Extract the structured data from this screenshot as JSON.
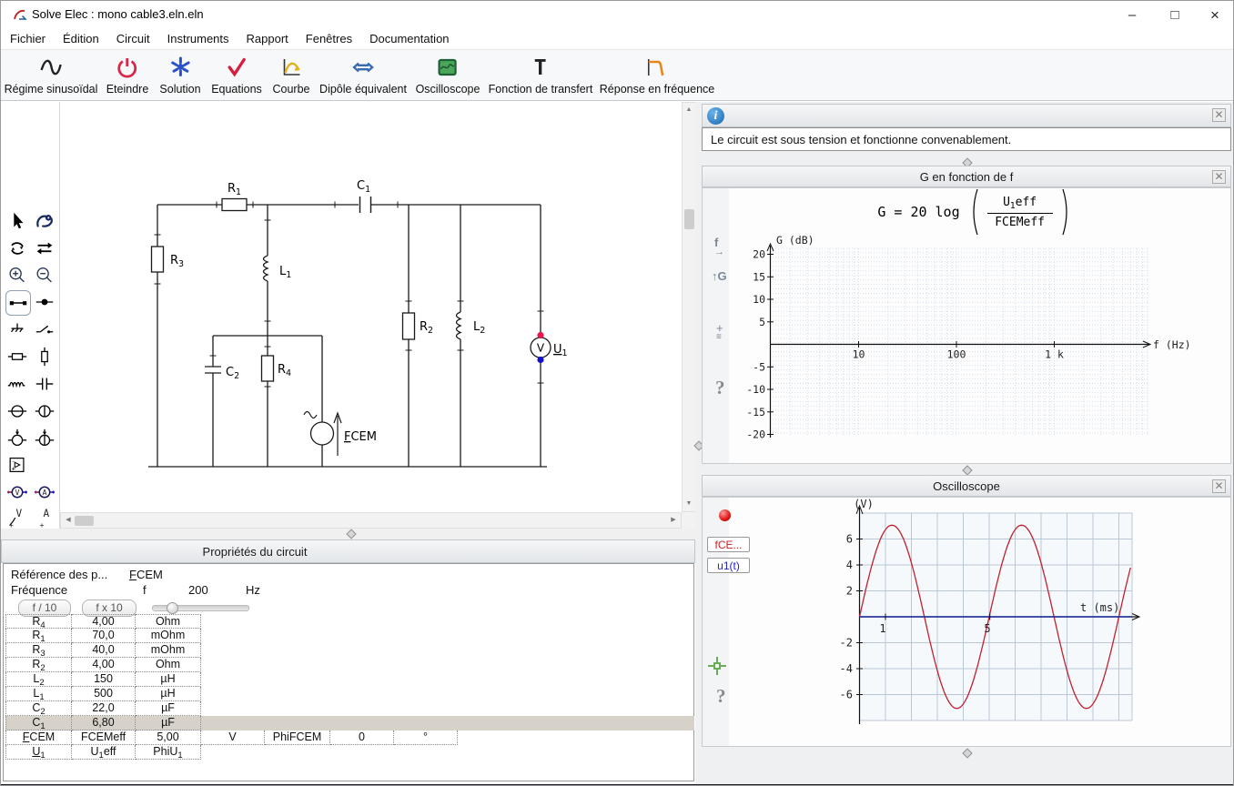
{
  "window": {
    "title": "Solve Elec : mono cable3.eln.eln"
  },
  "menubar": {
    "items": [
      "Fichier",
      "Édition",
      "Circuit",
      "Instruments",
      "Rapport",
      "Fenêtres",
      "Documentation"
    ]
  },
  "toolbar": {
    "items": [
      {
        "label": "Régime sinusoïdal",
        "icon": "sine-wave-icon"
      },
      {
        "label": "Eteindre",
        "icon": "power-icon"
      },
      {
        "label": "Solution",
        "icon": "asterisk-icon"
      },
      {
        "label": "Equations",
        "icon": "checkmark-icon"
      },
      {
        "label": "Courbe",
        "icon": "curve-icon"
      },
      {
        "label": "Dipôle équivalent",
        "icon": "double-arrow-icon"
      },
      {
        "label": "Oscilloscope",
        "icon": "oscilloscope-screen-icon"
      },
      {
        "label": "Fonction de transfert",
        "icon": "transfer-function-icon"
      },
      {
        "label": "Réponse en fréquence",
        "icon": "frequency-response-icon"
      }
    ]
  },
  "tool_palette": {
    "selected_tool": "wire-tool"
  },
  "circuit": {
    "labels": {
      "r1": {
        "main": "R",
        "sub": "1"
      },
      "r2": {
        "main": "R",
        "sub": "2"
      },
      "r3": {
        "main": "R",
        "sub": "3"
      },
      "r4": {
        "main": "R",
        "sub": "4"
      },
      "l1": {
        "main": "L",
        "sub": "1"
      },
      "l2": {
        "main": "L",
        "sub": "2"
      },
      "c1": {
        "main": "C",
        "sub": "1"
      },
      "c2": {
        "main": "C",
        "sub": "2"
      },
      "fcem": {
        "underlined": "F",
        "rest": "CEM"
      },
      "u1": {
        "underlined": "U",
        "sub": "1"
      },
      "voltmeter_letter": "V"
    }
  },
  "properties_panel": {
    "title": "Propriétés du circuit",
    "reference_row": {
      "label": "Référence des p...",
      "value_underlined": "F",
      "value_rest": "CEM"
    },
    "frequency_row": {
      "label": "Fréquence",
      "symbol": "f",
      "value": "200",
      "unit": "Hz"
    },
    "freq_buttons": {
      "divide": "f / 10",
      "multiply": "f x 10"
    },
    "frequency_slider": {
      "position_percent": 14
    },
    "component_rows": [
      {
        "name": "R",
        "sub": "4",
        "value": "4,00",
        "unit": "Ohm"
      },
      {
        "name": "R",
        "sub": "1",
        "value": "70,0",
        "unit": "mOhm"
      },
      {
        "name": "R",
        "sub": "3",
        "value": "40,0",
        "unit": "mOhm"
      },
      {
        "name": "R",
        "sub": "2",
        "value": "4,00",
        "unit": "Ohm"
      },
      {
        "name": "L",
        "sub": "2",
        "value": "150",
        "unit": "µH"
      },
      {
        "name": "L",
        "sub": "1",
        "value": "500",
        "unit": "µH"
      },
      {
        "name": "C",
        "sub": "2",
        "value": "22,0",
        "unit": "µF"
      },
      {
        "name": "C",
        "sub": "1",
        "value": "6,80",
        "unit": "µF"
      }
    ],
    "highlighted_row": "C1",
    "fcem_row": {
      "name_underlined": "F",
      "name_rest": "CEM",
      "eff_label": "FCEMeff",
      "eff_value": "5,00",
      "eff_unit": "V",
      "phase_label": "PhiFCEM",
      "phase_value": "0",
      "phase_unit": "°"
    },
    "u1_row": {
      "name_underlined": "U",
      "name_sub": "1",
      "eff_main": "U",
      "eff_sub": "1",
      "eff_rest": "eff",
      "phase_main": "PhiU",
      "phase_sub": "1"
    }
  },
  "info_panel": {
    "message": "Le circuit est sous tension et fonctionne convenablement."
  },
  "gain_panel": {
    "title": "G en fonction de f",
    "formula": {
      "lhs": "G",
      "equals": "=",
      "factor": "20 log",
      "numerator_main": "U",
      "numerator_sub": "1",
      "numerator_rest": "eff",
      "denominator": "FCEMeff"
    }
  },
  "oscilloscope_panel": {
    "title": "Oscilloscope",
    "signal_buttons": [
      {
        "label": "fCE...",
        "color": "#cc1f1f"
      },
      {
        "label": "u1(t)",
        "color": "#2323cc"
      }
    ]
  },
  "chart_data": [
    {
      "id": "gain_vs_frequency",
      "type": "line",
      "title": "G en fonction de f",
      "ylabel": "G (dB)",
      "xlabel": "f (Hz)",
      "xscale": "log",
      "xrange": [
        1,
        10000
      ],
      "xticks": [
        "10",
        "100",
        "1 k"
      ],
      "yrange": [
        -20,
        20
      ],
      "ytick_step": 5,
      "yticks": [
        20,
        15,
        10,
        5,
        -5,
        -10,
        -15,
        -20
      ],
      "grid": true,
      "series": []
    },
    {
      "id": "oscilloscope",
      "type": "line",
      "xlabel": "t (ms)",
      "ylabel": "(V)",
      "xrange": [
        0,
        10.5
      ],
      "yrange": [
        -8,
        8
      ],
      "xticks": [
        1,
        5
      ],
      "yticks": [
        6,
        4,
        2,
        -2,
        -4,
        -6
      ],
      "grid": true,
      "series": [
        {
          "name": "fCEM",
          "color": "#c2202e",
          "waveform": "sine",
          "amplitude_V": 7.07,
          "period_ms": 5,
          "phase_deg": 0,
          "sample_t_ms": [
            0,
            1.25,
            2.5,
            3.75,
            5,
            6.25,
            7.5,
            8.75,
            10
          ],
          "sample_V": [
            0,
            7.07,
            0,
            -7.07,
            0,
            7.07,
            0,
            -7.07,
            0
          ]
        },
        {
          "name": "u1(t)",
          "color": "#1c2da0",
          "waveform": "constant",
          "value_V": 0
        }
      ]
    }
  ]
}
